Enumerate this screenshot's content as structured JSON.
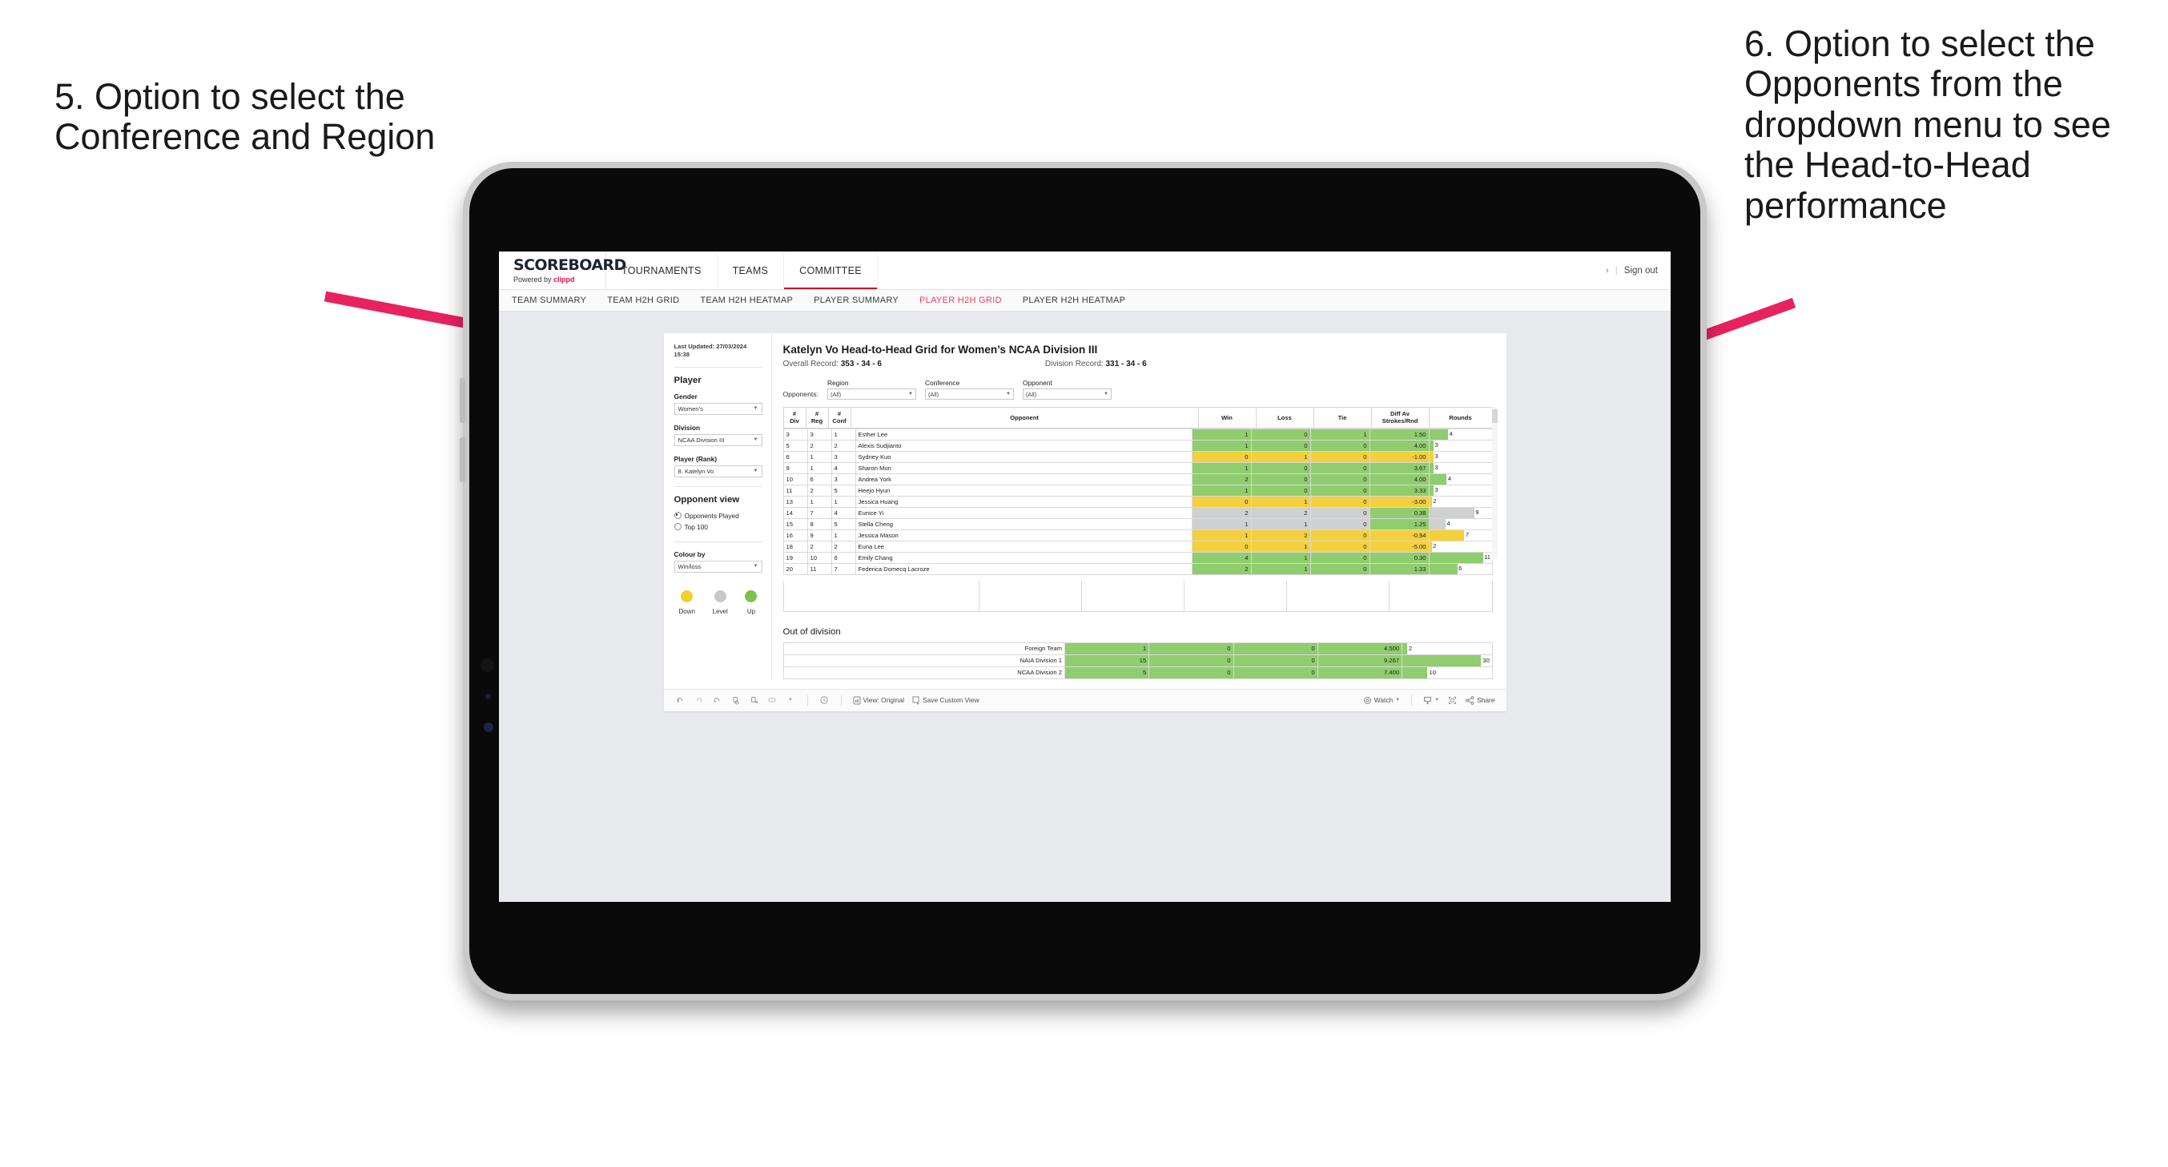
{
  "annotations": {
    "left": "5. Option to select the Conference and Region",
    "right": "6. Option to select the Opponents from the dropdown menu to see the Head-to-Head performance",
    "arrow_color": "#E8225F"
  },
  "app": {
    "brand": {
      "name": "SCOREBOARD",
      "powered_prefix": "Powered by ",
      "powered_brand": "clippd"
    },
    "nav": [
      {
        "label": "TOURNAMENTS",
        "active": false
      },
      {
        "label": "TEAMS",
        "active": false
      },
      {
        "label": "COMMITTEE",
        "active": true
      }
    ],
    "nav_right": {
      "chevron": "›",
      "separator": "|",
      "sign_out": "Sign out"
    },
    "subnav": [
      {
        "label": "TEAM SUMMARY",
        "active": false
      },
      {
        "label": "TEAM H2H GRID",
        "active": false
      },
      {
        "label": "TEAM H2H HEATMAP",
        "active": false
      },
      {
        "label": "PLAYER SUMMARY",
        "active": false
      },
      {
        "label": "PLAYER H2H GRID",
        "active": true
      },
      {
        "label": "PLAYER H2H HEATMAP",
        "active": false
      }
    ],
    "accent": "#EF3B5B"
  },
  "sidebar": {
    "last_updated": "Last Updated: 27/03/2024 15:38",
    "player_section": "Player",
    "fields": [
      {
        "label": "Gender",
        "value": "Women’s"
      },
      {
        "label": "Division",
        "value": "NCAA Division III"
      },
      {
        "label": "Player (Rank)",
        "value": "8. Katelyn Vo"
      }
    ],
    "opponent_view": {
      "title": "Opponent view",
      "options": [
        {
          "label": "Opponents Played",
          "selected": true
        },
        {
          "label": "Top 100",
          "selected": false
        }
      ]
    },
    "colour_by": {
      "label": "Colour by",
      "value": "Win/loss"
    },
    "legend": [
      {
        "label": "Down",
        "color": "#F2D02F"
      },
      {
        "label": "Level",
        "color": "#C6C8CA"
      },
      {
        "label": "Up",
        "color": "#7CC24A"
      }
    ]
  },
  "main": {
    "title": "Katelyn Vo Head-to-Head Grid for Women’s NCAA Division III",
    "overall_record_label": "Overall Record:",
    "overall_record_value": "353 - 34 - 6",
    "division_record_label": "Division Record:",
    "division_record_value": "331 - 34 - 6",
    "filters": {
      "prefix": "Opponents:",
      "items": [
        {
          "label": "Region",
          "value": "(All)"
        },
        {
          "label": "Conference",
          "value": "(All)"
        },
        {
          "label": "Opponent",
          "value": "(All)"
        }
      ]
    },
    "table": {
      "headers": [
        "# Div",
        "# Reg",
        "# Conf",
        "Opponent",
        "Win",
        "Loss",
        "Tie",
        "Diff Av Strokes/Rnd",
        "Rounds"
      ],
      "rows": [
        {
          "div": "3",
          "reg": "3",
          "conf": "1",
          "opponent": "Esther Lee",
          "win": "1",
          "loss": "0",
          "tie": "1",
          "diff": "1.50",
          "rounds": "4",
          "colour": "green",
          "bar_pct": 30
        },
        {
          "div": "5",
          "reg": "2",
          "conf": "2",
          "opponent": "Alexis Sudjianto",
          "win": "1",
          "loss": "0",
          "tie": "0",
          "diff": "4.00",
          "rounds": "3",
          "colour": "green",
          "bar_pct": 7
        },
        {
          "div": "6",
          "reg": "1",
          "conf": "3",
          "opponent": "Sydney Kuo",
          "win": "0",
          "loss": "1",
          "tie": "0",
          "diff": "-1.00",
          "rounds": "3",
          "colour": "yellow",
          "bar_pct": 7
        },
        {
          "div": "9",
          "reg": "1",
          "conf": "4",
          "opponent": "Sharon Mun",
          "win": "1",
          "loss": "0",
          "tie": "0",
          "diff": "3.67",
          "rounds": "3",
          "colour": "green",
          "bar_pct": 7
        },
        {
          "div": "10",
          "reg": "6",
          "conf": "3",
          "opponent": "Andrea York",
          "win": "2",
          "loss": "0",
          "tie": "0",
          "diff": "4.00",
          "rounds": "4",
          "colour": "green",
          "bar_pct": 28
        },
        {
          "div": "11",
          "reg": "2",
          "conf": "5",
          "opponent": "Heejo Hyun",
          "win": "1",
          "loss": "0",
          "tie": "0",
          "diff": "3.33",
          "rounds": "3",
          "colour": "green",
          "bar_pct": 7
        },
        {
          "div": "13",
          "reg": "1",
          "conf": "1",
          "opponent": "Jessica Huang",
          "win": "0",
          "loss": "1",
          "tie": "0",
          "diff": "-3.00",
          "rounds": "2",
          "colour": "yellow",
          "bar_pct": 4
        },
        {
          "div": "14",
          "reg": "7",
          "conf": "4",
          "opponent": "Eunice Yi",
          "win": "2",
          "loss": "2",
          "tie": "0",
          "diff": "0.38",
          "rounds": "9",
          "colour": "grey",
          "bar_pct": 72,
          "diff_colour": "green"
        },
        {
          "div": "15",
          "reg": "8",
          "conf": "5",
          "opponent": "Stella Cheng",
          "win": "1",
          "loss": "1",
          "tie": "0",
          "diff": "1.25",
          "rounds": "4",
          "colour": "grey",
          "bar_pct": 26,
          "diff_colour": "green"
        },
        {
          "div": "16",
          "reg": "9",
          "conf": "1",
          "opponent": "Jessica Mason",
          "win": "1",
          "loss": "2",
          "tie": "0",
          "diff": "-0.94",
          "rounds": "7",
          "colour": "yellow",
          "bar_pct": 56
        },
        {
          "div": "18",
          "reg": "2",
          "conf": "2",
          "opponent": "Euna Lee",
          "win": "0",
          "loss": "1",
          "tie": "0",
          "diff": "-5.00",
          "rounds": "2",
          "colour": "yellow",
          "bar_pct": 4
        },
        {
          "div": "19",
          "reg": "10",
          "conf": "6",
          "opponent": "Emily Chang",
          "win": "4",
          "loss": "1",
          "tie": "0",
          "diff": "0.30",
          "rounds": "11",
          "colour": "green",
          "bar_pct": 86
        },
        {
          "div": "20",
          "reg": "11",
          "conf": "7",
          "opponent": "Federica Domecq Lacroze",
          "win": "2",
          "loss": "1",
          "tie": "0",
          "diff": "1.33",
          "rounds": "6",
          "colour": "green",
          "bar_pct": 45
        }
      ]
    },
    "out_of_division": {
      "title": "Out of division",
      "rows": [
        {
          "name": "Foreign Team",
          "win": "1",
          "loss": "0",
          "tie": "0",
          "diff": "4.500",
          "rounds": "2",
          "colour": "green",
          "bar_pct": 5
        },
        {
          "name": "NAIA Division 1",
          "win": "15",
          "loss": "0",
          "tie": "0",
          "diff": "9.267",
          "rounds": "30",
          "colour": "green",
          "bar_pct": 88
        },
        {
          "name": "NCAA Division 2",
          "win": "5",
          "loss": "0",
          "tie": "0",
          "diff": "7.400",
          "rounds": "10",
          "colour": "green",
          "bar_pct": 28
        }
      ]
    }
  },
  "toolbar": {
    "icons": [
      "undo-icon",
      "redo-icon",
      "revert-icon",
      "refresh-data-icon",
      "pause-auto-update-icon",
      "highlight-icon",
      "highlight-dropdown-caret"
    ],
    "alert_icon": "alert-icon",
    "view_label": "View: Original",
    "save_custom_view_label": "Save Custom View",
    "watch_label": "Watch",
    "download_icon": "download-icon",
    "fullscreen_icon": "fullscreen-icon",
    "share_label": "Share"
  }
}
